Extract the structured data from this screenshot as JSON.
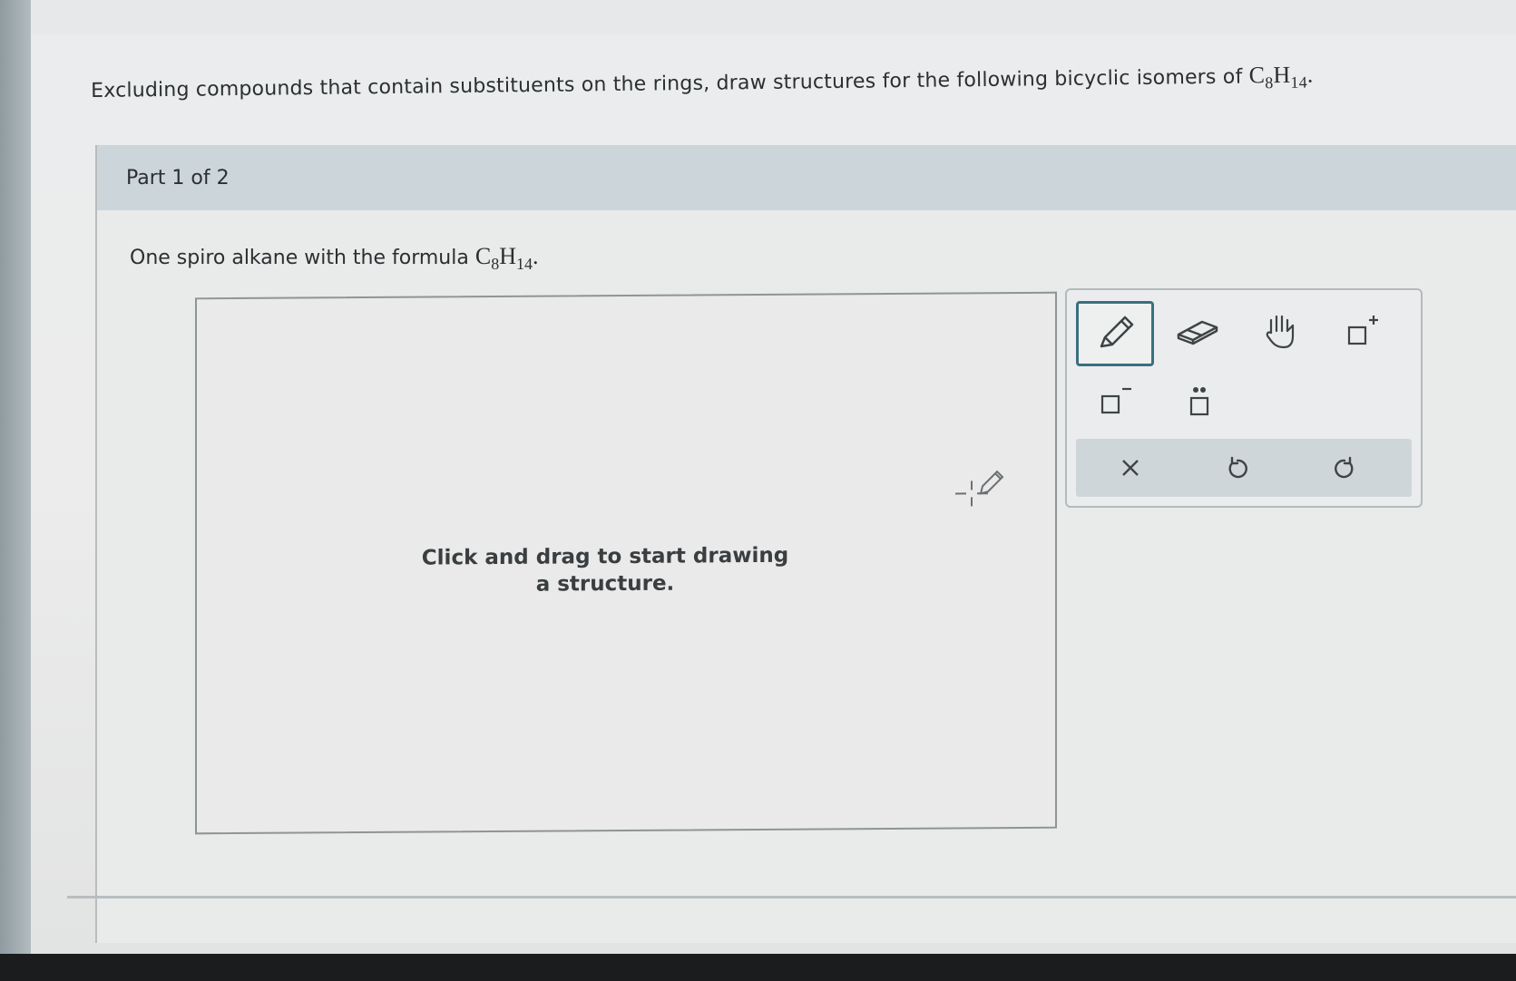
{
  "question": {
    "text": "Excluding compounds that contain substituents on the rings, draw structures for the following bicyclic isomers of",
    "formula": {
      "c": "C",
      "c_sub": "8",
      "h": "H",
      "h_sub": "14"
    },
    "period": "."
  },
  "part": {
    "title": "Part 1 of 2",
    "prompt": "One spiro alkane with the formula",
    "formula": {
      "c": "C",
      "c_sub": "8",
      "h": "H",
      "h_sub": "14"
    },
    "period": "."
  },
  "canvas": {
    "hint": "Click and drag to start drawing a structure."
  },
  "toolbar": {
    "tools": [
      "pencil-icon",
      "eraser-icon",
      "hand-icon",
      "add-positive-charge-icon",
      "add-negative-charge-icon",
      "add-lone-pair-icon"
    ],
    "actions": [
      "clear-icon",
      "undo-icon",
      "redo-icon"
    ],
    "active_tool": "pencil-icon",
    "accent_color": "#3a6f80"
  }
}
